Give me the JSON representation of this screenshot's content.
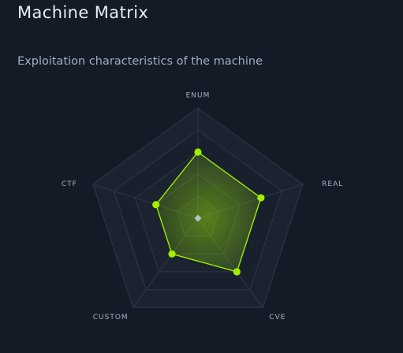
{
  "header": {
    "title": "Machine Matrix",
    "subtitle": "Exploitation characteristics of the machine"
  },
  "colors": {
    "background": "#131b27",
    "grid_stroke": "#2b3444",
    "accent": "#9fef00",
    "center_marker": "#b6c2d1"
  },
  "chart_data": {
    "type": "radar",
    "title": "",
    "axes": [
      "ENUM",
      "REAL",
      "CVE",
      "CUSTOM",
      "CTF"
    ],
    "max": 10,
    "rings": 5,
    "series": [
      {
        "values": [
          6,
          6,
          6,
          4,
          4
        ]
      }
    ]
  }
}
